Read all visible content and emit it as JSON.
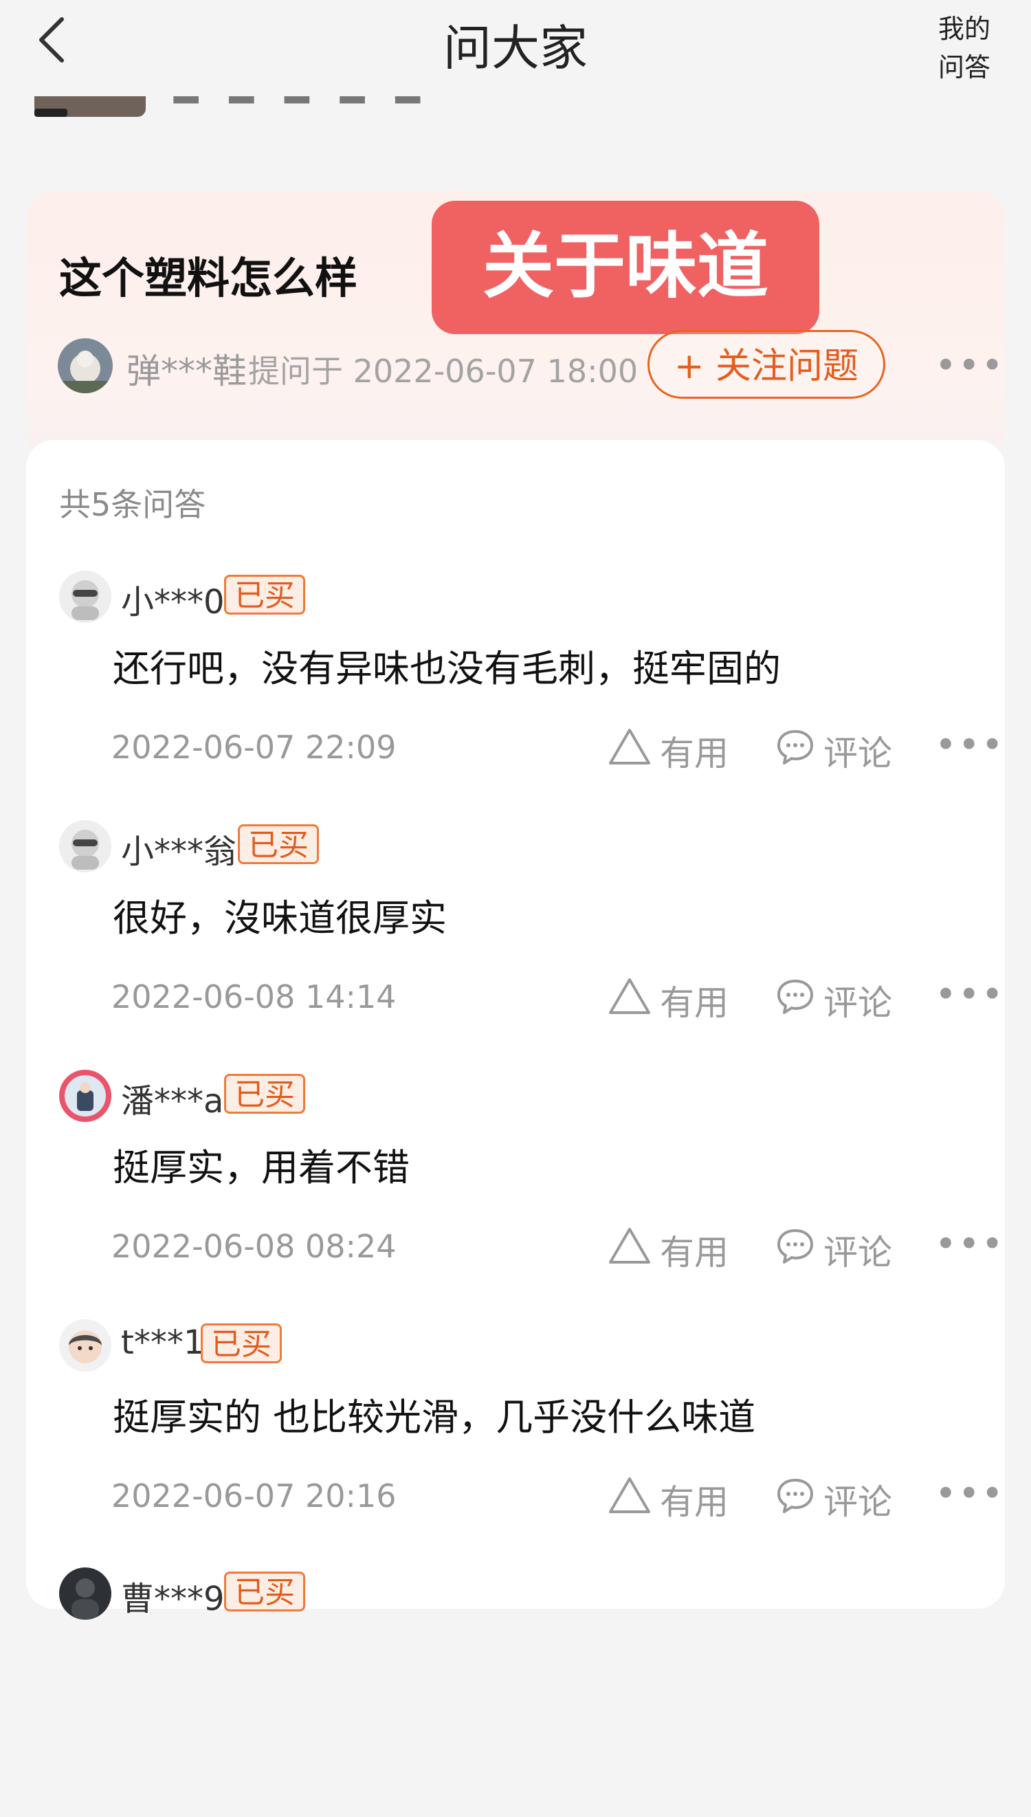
{
  "header": {
    "title": "问大家",
    "my_qa_line1": "我的",
    "my_qa_line2": "问答"
  },
  "question": {
    "title": "这个塑料怎么样",
    "tag": "关于味道",
    "asker": "弹***鞋",
    "asked_at": "提问于 2022-06-07 18:00",
    "follow_label": "+ 关注问题",
    "more": "•••"
  },
  "answers_summary": "共5条问答",
  "answers": [
    {
      "user": "小***0",
      "badge": "已买",
      "text": "还行吧，没有异味也没有毛刺，挺牢固的",
      "time": "2022-06-07 22:09",
      "useful": "有用",
      "comment": "评论",
      "more": "•••"
    },
    {
      "user": "小***翁",
      "badge": "已买",
      "text": "很好，沒味道很厚实",
      "time": "2022-06-08 14:14",
      "useful": "有用",
      "comment": "评论",
      "more": "•••"
    },
    {
      "user": "潘***a",
      "badge": "已买",
      "text": "挺厚实，用着不错",
      "time": "2022-06-08 08:24",
      "useful": "有用",
      "comment": "评论",
      "more": "•••"
    },
    {
      "user": "t***1",
      "badge": "已买",
      "text": "挺厚实的 也比较光滑，几乎没什么味道",
      "time": "2022-06-07 20:16",
      "useful": "有用",
      "comment": "评论",
      "more": "•••"
    },
    {
      "user": "曹***9",
      "badge": "已买"
    }
  ],
  "colors": {
    "accent": "#e9641f",
    "tag_bg": "#f06262",
    "muted_text": "#999999"
  }
}
